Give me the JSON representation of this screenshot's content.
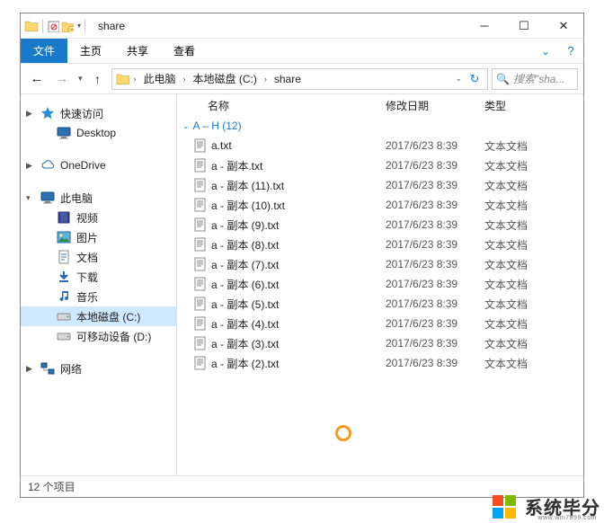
{
  "window": {
    "title": "share"
  },
  "ribbon": {
    "tabs": {
      "file": "文件",
      "home": "主页",
      "share": "共享",
      "view": "查看"
    }
  },
  "breadcrumb": {
    "seg1": "此电脑",
    "seg2": "本地磁盘 (C:)",
    "seg3": "share"
  },
  "search": {
    "placeholder": "搜索\"sha..."
  },
  "sidebar": {
    "quick": "快速访问",
    "desktop": "Desktop",
    "onedrive": "OneDrive",
    "thispc": "此电脑",
    "videos": "视频",
    "pictures": "图片",
    "documents": "文档",
    "downloads": "下载",
    "music": "音乐",
    "localdisk": "本地磁盘 (C:)",
    "removable": "可移动设备 (D:)",
    "network": "网络"
  },
  "columns": {
    "name": "名称",
    "date": "修改日期",
    "type": "类型"
  },
  "group": {
    "label": "A – H (12)"
  },
  "files": [
    {
      "name": "a.txt",
      "date": "2017/6/23 8:39",
      "type": "文本文档"
    },
    {
      "name": "a - 副本.txt",
      "date": "2017/6/23 8:39",
      "type": "文本文档"
    },
    {
      "name": "a - 副本 (11).txt",
      "date": "2017/6/23 8:39",
      "type": "文本文档"
    },
    {
      "name": "a - 副本 (10).txt",
      "date": "2017/6/23 8:39",
      "type": "文本文档"
    },
    {
      "name": "a - 副本 (9).txt",
      "date": "2017/6/23 8:39",
      "type": "文本文档"
    },
    {
      "name": "a - 副本 (8).txt",
      "date": "2017/6/23 8:39",
      "type": "文本文档"
    },
    {
      "name": "a - 副本 (7).txt",
      "date": "2017/6/23 8:39",
      "type": "文本文档"
    },
    {
      "name": "a - 副本 (6).txt",
      "date": "2017/6/23 8:39",
      "type": "文本文档"
    },
    {
      "name": "a - 副本 (5).txt",
      "date": "2017/6/23 8:39",
      "type": "文本文档"
    },
    {
      "name": "a - 副本 (4).txt",
      "date": "2017/6/23 8:39",
      "type": "文本文档"
    },
    {
      "name": "a - 副本 (3).txt",
      "date": "2017/6/23 8:39",
      "type": "文本文档"
    },
    {
      "name": "a - 副本 (2).txt",
      "date": "2017/6/23 8:39",
      "type": "文本文档"
    }
  ],
  "status": {
    "count": "12 个项目"
  },
  "watermark": {
    "brand": "系统毕分",
    "url": "www.win7999.com"
  }
}
